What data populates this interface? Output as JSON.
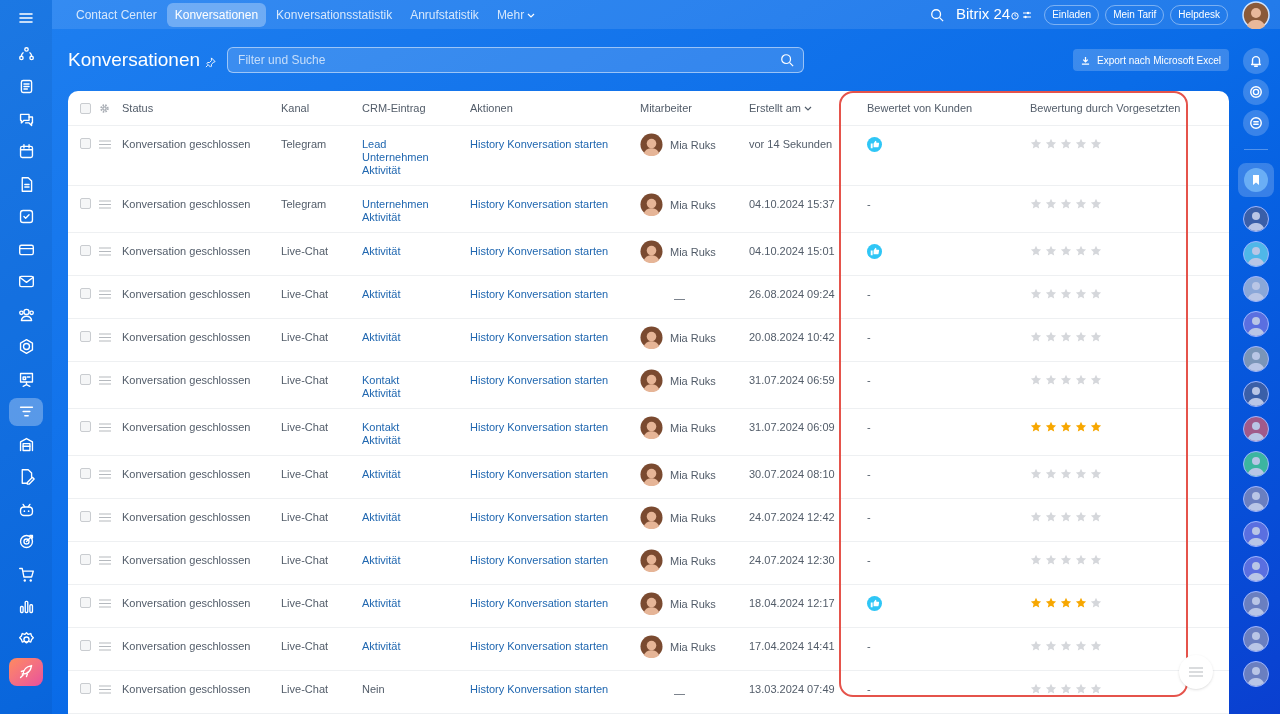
{
  "topbar": {
    "tabs": [
      {
        "label": "Contact Center",
        "selected": false
      },
      {
        "label": "Konversationen",
        "selected": true
      },
      {
        "label": "Konversationsstatistik",
        "selected": false
      },
      {
        "label": "Anrufstatistik",
        "selected": false
      },
      {
        "label": "Mehr",
        "selected": false
      }
    ],
    "logo": "Bitrix 24",
    "buttons": [
      "Einladen",
      "Mein Tarif",
      "Helpdesk"
    ]
  },
  "sidebar": {
    "items": [
      {
        "selected": false
      },
      {
        "selected": false
      },
      {
        "selected": false
      },
      {
        "selected": false
      },
      {
        "selected": false
      },
      {
        "selected": false
      },
      {
        "selected": false
      },
      {
        "selected": false
      },
      {
        "selected": false
      },
      {
        "selected": false
      },
      {
        "selected": false
      },
      {
        "selected": true
      },
      {
        "selected": false
      },
      {
        "selected": false
      },
      {
        "selected": false
      },
      {
        "selected": false
      },
      {
        "selected": false
      },
      {
        "selected": false
      },
      {
        "selected": false
      },
      {
        "selected": false
      }
    ]
  },
  "page": {
    "title": "Konversationen",
    "search": {
      "placeholder": "Filter und Suche"
    },
    "export_button": "Export nach Microsoft Excel"
  },
  "table": {
    "all_checked": false,
    "columns": [
      "Status",
      "Kanal",
      "CRM-Eintrag",
      "Aktionen",
      "Mitarbeiter",
      "Erstellt am",
      "Bewertet von Kunden",
      "Bewertung durch Vorgesetzten"
    ],
    "rows": [
      {
        "checked": false,
        "status": "Konversation geschlossen",
        "channel": "Telegram",
        "crm": [
          {
            "kind": "link",
            "text": "Lead"
          },
          {
            "kind": "link",
            "text": "Unternehmen"
          },
          {
            "kind": "link",
            "text": "Aktivität"
          }
        ],
        "action": "History Konversation starten",
        "employee": {
          "kind": "person",
          "text": "Mia Ruks"
        },
        "created": "vor 14 Sekunden",
        "customer_rating": {
          "kind": "like"
        },
        "stars": 0
      },
      {
        "checked": false,
        "status": "Konversation geschlossen",
        "channel": "Telegram",
        "crm": [
          {
            "kind": "link",
            "text": "Unternehmen"
          },
          {
            "kind": "link",
            "text": "Aktivität"
          }
        ],
        "action": "History Konversation starten",
        "employee": {
          "kind": "person",
          "text": "Mia Ruks"
        },
        "created": "04.10.2024 15:37",
        "customer_rating": {
          "kind": "none",
          "text": "-"
        },
        "stars": 0
      },
      {
        "checked": false,
        "status": "Konversation geschlossen",
        "channel": "Live-Chat",
        "crm": [
          {
            "kind": "link",
            "text": "Aktivität"
          }
        ],
        "action": "History Konversation starten",
        "employee": {
          "kind": "person",
          "text": "Mia Ruks"
        },
        "created": "04.10.2024 15:01",
        "customer_rating": {
          "kind": "like"
        },
        "stars": 0
      },
      {
        "checked": false,
        "status": "Konversation geschlossen",
        "channel": "Live-Chat",
        "crm": [
          {
            "kind": "link",
            "text": "Aktivität"
          }
        ],
        "action": "History Konversation starten",
        "employee": {
          "kind": "none",
          "text": "—"
        },
        "created": "26.08.2024 09:24",
        "customer_rating": {
          "kind": "none",
          "text": "-"
        },
        "stars": 0
      },
      {
        "checked": false,
        "status": "Konversation geschlossen",
        "channel": "Live-Chat",
        "crm": [
          {
            "kind": "link",
            "text": "Aktivität"
          }
        ],
        "action": "History Konversation starten",
        "employee": {
          "kind": "person",
          "text": "Mia Ruks"
        },
        "created": "20.08.2024 10:42",
        "customer_rating": {
          "kind": "none",
          "text": "-"
        },
        "stars": 0
      },
      {
        "checked": false,
        "status": "Konversation geschlossen",
        "channel": "Live-Chat",
        "crm": [
          {
            "kind": "link",
            "text": "Kontakt"
          },
          {
            "kind": "link",
            "text": "Aktivität"
          }
        ],
        "action": "History Konversation starten",
        "employee": {
          "kind": "person",
          "text": "Mia Ruks"
        },
        "created": "31.07.2024 06:59",
        "customer_rating": {
          "kind": "none",
          "text": "-"
        },
        "stars": 0
      },
      {
        "checked": false,
        "status": "Konversation geschlossen",
        "channel": "Live-Chat",
        "crm": [
          {
            "kind": "link",
            "text": "Kontakt"
          },
          {
            "kind": "link",
            "text": "Aktivität"
          }
        ],
        "action": "History Konversation starten",
        "employee": {
          "kind": "person",
          "text": "Mia Ruks"
        },
        "created": "31.07.2024 06:09",
        "customer_rating": {
          "kind": "none",
          "text": "-"
        },
        "stars": 5
      },
      {
        "checked": false,
        "status": "Konversation geschlossen",
        "channel": "Live-Chat",
        "crm": [
          {
            "kind": "link",
            "text": "Aktivität"
          }
        ],
        "action": "History Konversation starten",
        "employee": {
          "kind": "person",
          "text": "Mia Ruks"
        },
        "created": "30.07.2024 08:10",
        "customer_rating": {
          "kind": "none",
          "text": "-"
        },
        "stars": 0
      },
      {
        "checked": false,
        "status": "Konversation geschlossen",
        "channel": "Live-Chat",
        "crm": [
          {
            "kind": "link",
            "text": "Aktivität"
          }
        ],
        "action": "History Konversation starten",
        "employee": {
          "kind": "person",
          "text": "Mia Ruks"
        },
        "created": "24.07.2024 12:42",
        "customer_rating": {
          "kind": "none",
          "text": "-"
        },
        "stars": 0
      },
      {
        "checked": false,
        "status": "Konversation geschlossen",
        "channel": "Live-Chat",
        "crm": [
          {
            "kind": "link",
            "text": "Aktivität"
          }
        ],
        "action": "History Konversation starten",
        "employee": {
          "kind": "person",
          "text": "Mia Ruks"
        },
        "created": "24.07.2024 12:30",
        "customer_rating": {
          "kind": "none",
          "text": "-"
        },
        "stars": 0
      },
      {
        "checked": false,
        "status": "Konversation geschlossen",
        "channel": "Live-Chat",
        "crm": [
          {
            "kind": "link",
            "text": "Aktivität"
          }
        ],
        "action": "History Konversation starten",
        "employee": {
          "kind": "person",
          "text": "Mia Ruks"
        },
        "created": "18.04.2024 12:17",
        "customer_rating": {
          "kind": "like"
        },
        "stars": 4
      },
      {
        "checked": false,
        "status": "Konversation geschlossen",
        "channel": "Live-Chat",
        "crm": [
          {
            "kind": "link",
            "text": "Aktivität"
          }
        ],
        "action": "History Konversation starten",
        "employee": {
          "kind": "person",
          "text": "Mia Ruks"
        },
        "created": "17.04.2024 14:41",
        "customer_rating": {
          "kind": "none",
          "text": "-"
        },
        "stars": 0
      },
      {
        "checked": false,
        "status": "Konversation geschlossen",
        "channel": "Live-Chat",
        "crm": [
          {
            "kind": "text",
            "text": "Nein"
          }
        ],
        "action": "History Konversation starten",
        "employee": {
          "kind": "none",
          "text": "—"
        },
        "created": "13.03.2024 07:49",
        "customer_rating": {
          "kind": "none",
          "text": "-"
        },
        "stars": 0
      }
    ]
  }
}
